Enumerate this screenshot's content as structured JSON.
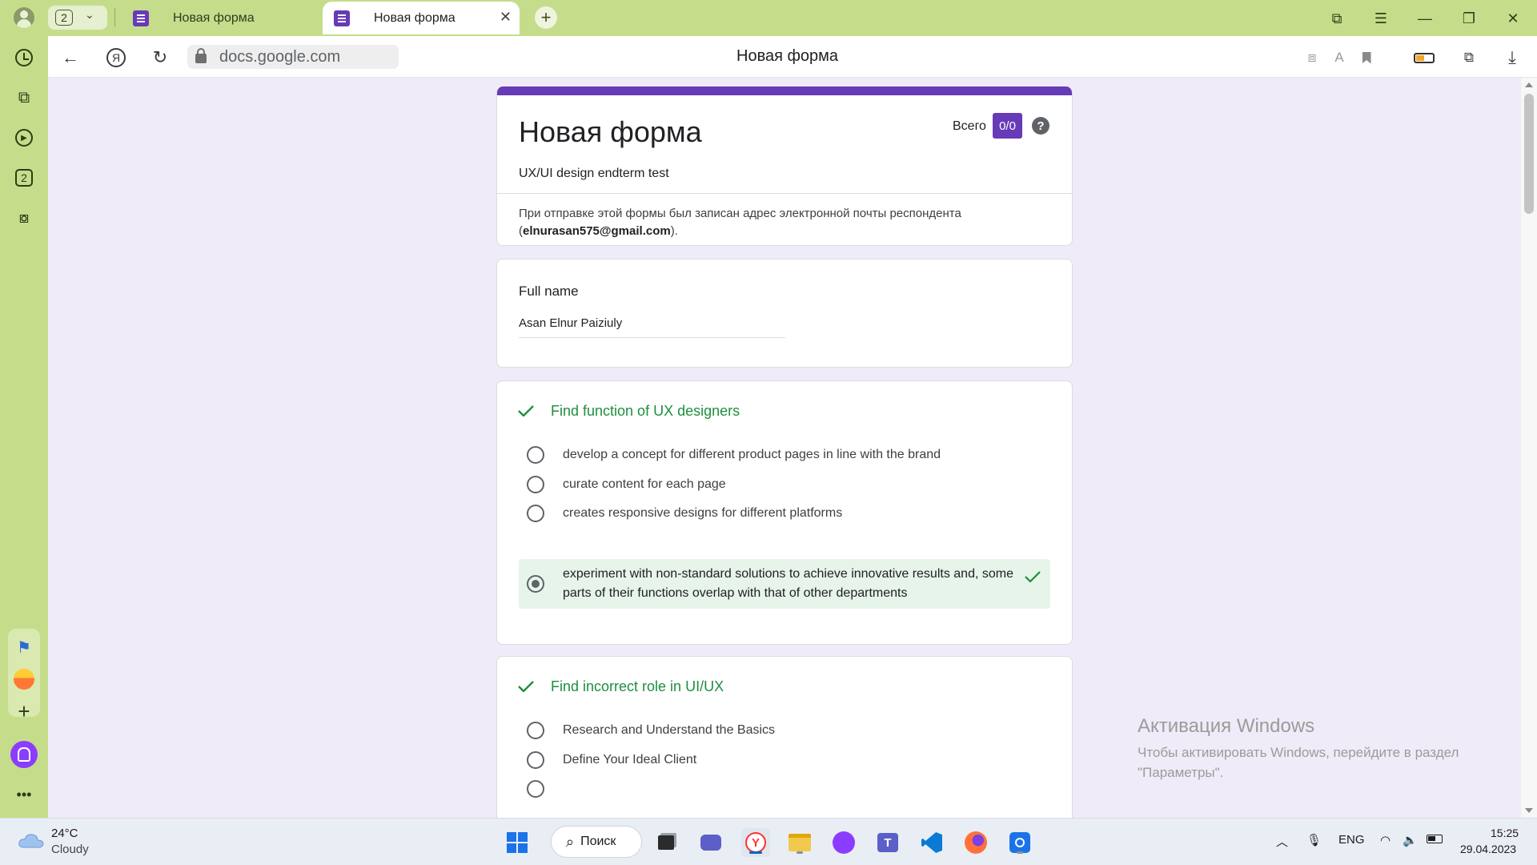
{
  "browser": {
    "tab_group_count": "2",
    "tabs": [
      {
        "title": "Новая форма",
        "active": false
      },
      {
        "title": "Новая форма",
        "active": true
      }
    ],
    "url": "docs.google.com",
    "page_title": "Новая форма"
  },
  "sidebar": {
    "tabs_count": "2"
  },
  "form": {
    "title": "Новая форма",
    "total_label": "Всего",
    "score": "0/0",
    "description": "UX/UI design endterm test",
    "email_note_prefix": "При отправке этой формы был записан адрес электронной почты респондента (",
    "email": "elnurasan575@gmail.com",
    "email_note_suffix": ").",
    "questions": [
      {
        "title": "Full name",
        "answer": "Asan Elnur Paiziuly"
      },
      {
        "title": "Find function of UX designers",
        "options": [
          "develop a concept for different product pages in line with the brand",
          "curate content for each page",
          "creates responsive designs for different platforms",
          "experiment with non-standard solutions to achieve innovative results and, some parts of their functions overlap with that of other departments"
        ],
        "selected_index": 3
      },
      {
        "title": "Find incorrect role in UI/UX",
        "options": [
          "Research and Understand the Basics",
          "Define Your Ideal Client"
        ]
      }
    ]
  },
  "watermark": {
    "title": "Активация Windows",
    "text": "Чтобы активировать Windows, перейдите в раздел \"Параметры\"."
  },
  "taskbar": {
    "weather_temp": "24°C",
    "weather_desc": "Cloudy",
    "search_label": "Поиск",
    "language": "ENG",
    "time": "15:25",
    "date": "29.04.2023"
  },
  "colors": {
    "browser_chrome": "#c5dd8b",
    "form_accent": "#673ab7",
    "page_background": "#f0ebf8",
    "correct_green": "#1e8e3e",
    "correct_fill": "#e6f4ea"
  }
}
